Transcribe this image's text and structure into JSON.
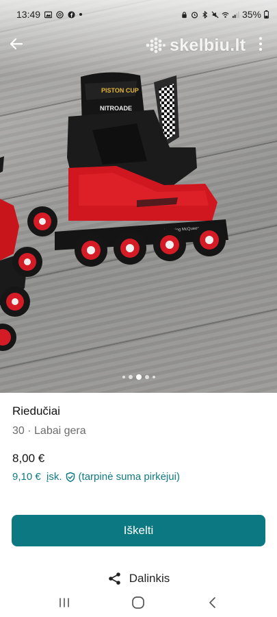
{
  "status_bar": {
    "time": "13:49",
    "battery": "35%"
  },
  "header": {
    "logo_text": "skelbiu.lt",
    "back_icon": "arrow-left-icon",
    "menu_icon": "more-vertical-icon"
  },
  "gallery": {
    "total_dots": 5,
    "active_index": 2
  },
  "listing": {
    "title": "Riedučiai",
    "subtitle": "30 · Labai gera",
    "price": "8,00 €",
    "price_with_fee": "9,10 €  įsk.",
    "fee_note": "(tarpinė suma pirkėjui)"
  },
  "actions": {
    "primary_label": "Iškelti",
    "share_label": "Dalinkis"
  },
  "colors": {
    "accent": "#0c7882",
    "fee_text": "#0f7a82"
  }
}
